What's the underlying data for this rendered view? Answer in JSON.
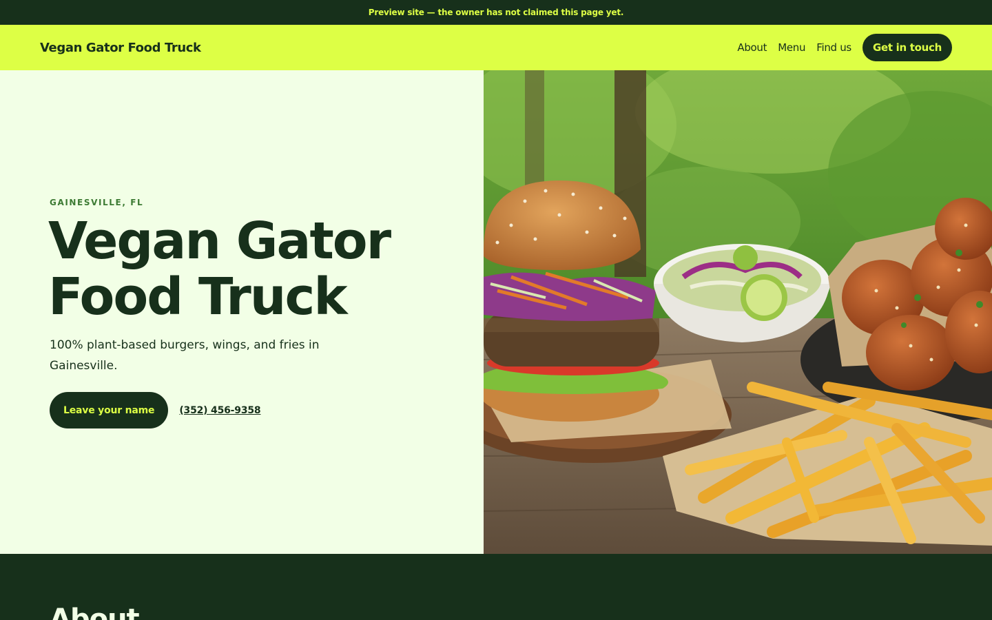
{
  "banner": {
    "text": "Preview site — the owner has not claimed this page yet."
  },
  "nav": {
    "brand": "Vegan Gator Food Truck",
    "links": [
      "About",
      "Menu",
      "Find us"
    ],
    "cta": "Get in touch"
  },
  "hero": {
    "eyebrow": "GAINESVILLE, FL",
    "title_line1": "Vegan Gator",
    "title_line2": "Food Truck",
    "subtitle": "100% plant-based burgers, wings, and fries in Gainesville.",
    "primary_button": "Leave your name",
    "phone": "(352) 456-9358"
  },
  "about": {
    "heading": "About"
  },
  "colors": {
    "dark_green": "#17301B",
    "lime": "#DDFF45",
    "mint_bg": "#F2FFE6",
    "eyebrow_green": "#3C7A33"
  }
}
